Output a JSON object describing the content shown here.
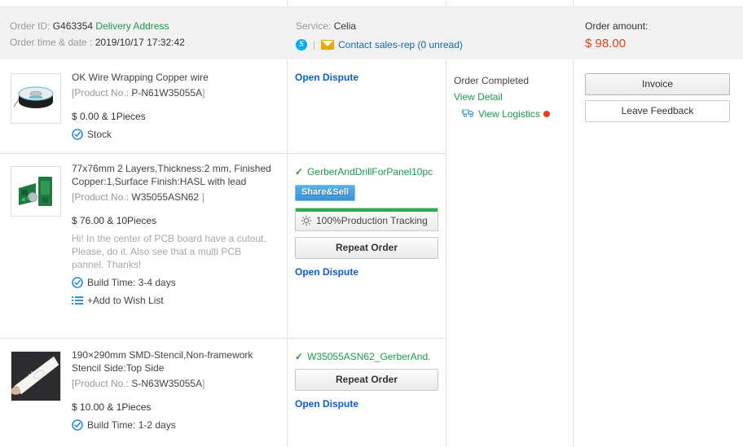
{
  "order": {
    "order_id_label": "Order ID:",
    "order_id": "G463354",
    "delivery_address_link": "Delivery Address",
    "order_time_label": "Order time & date :",
    "order_time": "2019/10/17 17:32:42",
    "service_label": "Service:",
    "service_agent": "Celia",
    "skype_icon": "skype-icon",
    "mail_icon": "envelope-icon",
    "contact_link": "Contact sales-rep (0 unread)",
    "amount_label": "Order amount:",
    "amount": "$ 98.00",
    "amount_color": "#e8431f"
  },
  "rows": [
    {
      "thumbnail": "copper-wire-spool-thumbnail",
      "title": "OK Wire Wrapping Copper wire",
      "product_no_label": "[Product No.:",
      "product_no": "P-N61W35055A",
      "product_no_close": "]",
      "price": "$ 0.00 & 1Pieces",
      "note": "",
      "meta_icon": "check-circle-icon",
      "meta": "Stock",
      "wishlist": null,
      "actions": {
        "file_name": null,
        "share_sell": null,
        "tracking": null,
        "repeat_order": null,
        "open_dispute": "Open Dispute"
      },
      "status": {
        "title": "Order Completed",
        "view_detail": "View Detail",
        "logistics_icon": "truck-icon",
        "view_logistics": "View Logistics",
        "has_alert_dot": true
      },
      "buttons": {
        "invoice": "Invoice",
        "leave_feedback": "Leave Feedback"
      }
    },
    {
      "thumbnail": "pcb-board-thumbnail",
      "title": "77x76mm 2 Layers,Thickness:2 mm, Finished Copper:1,Surface Finish:HASL with lead",
      "product_no_label": "[Product No.:",
      "product_no": "W35055ASN62",
      "product_no_close": "]",
      "price": "$ 76.00 & 10Pieces",
      "note": "Hi! In the center of PCB board have a cutout. Please, do it. Also see that a multi PCB pannel. Thanks!",
      "meta_icon": "check-circle-icon",
      "meta": "Build Time: 3-4 days",
      "wishlist_icon": "list-icon",
      "wishlist": "+Add to Wish List",
      "actions": {
        "file_name": "GerberAndDrillForPanel10pc",
        "share_sell": "Share&Sell",
        "tracking_icon": "gear-icon",
        "tracking": "100%Production Tracking",
        "tracking_percent": 100,
        "repeat_order": "Repeat Order",
        "open_dispute": "Open Dispute"
      },
      "status": null,
      "buttons": null
    },
    {
      "thumbnail": "smd-stencil-thumbnail",
      "title": "190×290mm SMD-Stencil,Non-framework Stencil Side:Top Side",
      "product_no_label": "[Product No.:",
      "product_no": "S-N63W35055A",
      "product_no_close": "]",
      "price": "$ 10.00 & 1Pieces",
      "note": "",
      "meta_icon": "check-circle-icon",
      "meta": "Build Time: 1-2 days",
      "wishlist": null,
      "actions": {
        "file_name": "W35055ASN62_GerberAnd.",
        "share_sell": null,
        "tracking": null,
        "repeat_order": "Repeat Order",
        "open_dispute": "Open Dispute"
      },
      "status": null,
      "buttons": null
    }
  ],
  "colors": {
    "green_link": "#1a9c4a",
    "blue_link": "#0b5ed7",
    "price_red": "#e8431f",
    "progress_green": "#22b14c",
    "alert_red": "#f23c14"
  }
}
